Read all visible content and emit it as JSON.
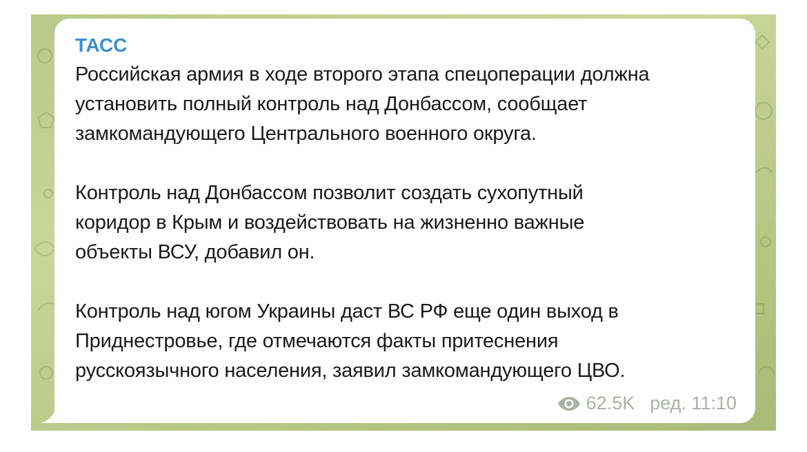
{
  "message": {
    "channel_name": "ТАСС",
    "paragraphs": [
      [
        "Российская армия в ходе второго этапа спецоперации должна",
        "установить полный контроль над Донбассом, сообщает",
        "замкомандующего Центрального военного округа."
      ],
      [
        "Контроль над Донбассом позволит создать сухопутный",
        "коридор в Крым и воздействовать на жизненно важные",
        "объекты ВСУ, добавил он."
      ],
      [
        "Контроль над югом Украины даст ВС РФ еще один выход в",
        "Приднестровье, где отмечаются факты притеснения",
        "русскоязычного населения, заявил замкомандующего ЦВО."
      ]
    ],
    "views": "62.5K",
    "edited_time": "ред. 11:10",
    "icons": {
      "views": "eye-icon"
    }
  },
  "colors": {
    "channel_name": "#3a8fd0",
    "text": "#1a1a1a",
    "meta": "#a9b3a4",
    "bubble": "#ffffff",
    "chat_background": "#bccb8c"
  }
}
